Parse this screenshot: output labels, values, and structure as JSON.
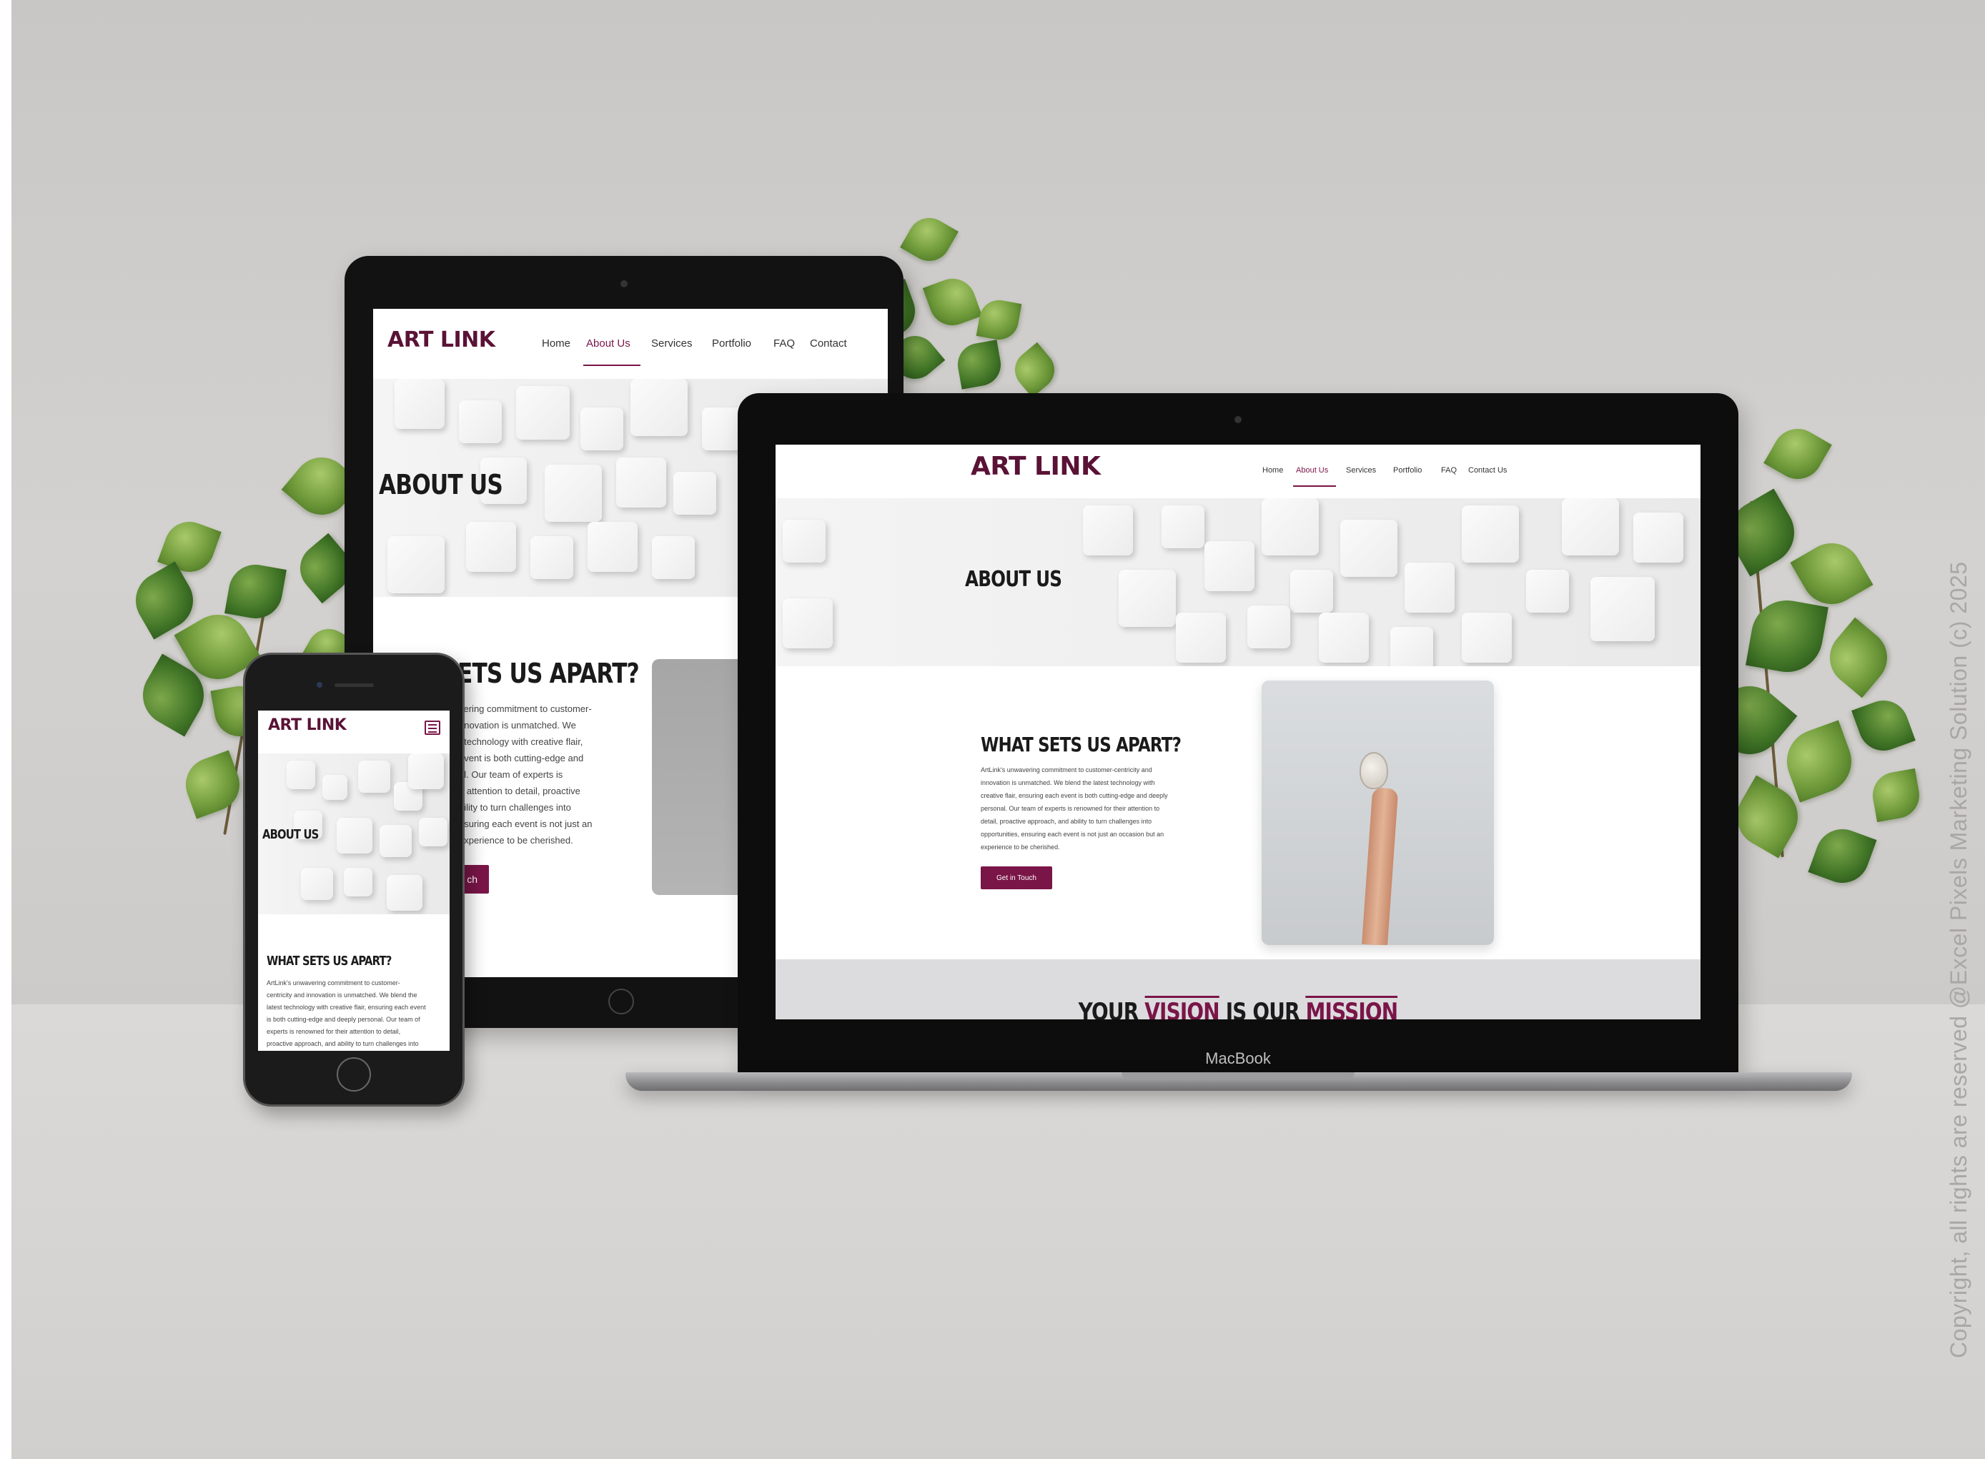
{
  "brand": {
    "logo_text": "ART LINK",
    "accent_color": "#7a1548"
  },
  "nav": {
    "items": [
      "Home",
      "About Us",
      "Services",
      "Portfolio",
      "FAQ",
      "Contact Us"
    ],
    "active": "About Us",
    "tablet_contact_truncated": "Contact"
  },
  "hero": {
    "title": "ABOUT US"
  },
  "section": {
    "heading": "WHAT SETS US APART?",
    "heading_tablet_cut": "ETS US APART?",
    "body": "ArtLink's unwavering commitment to customer-centricity and innovation is unmatched. We blend the latest technology with creative flair, ensuring each event is both cutting-edge and deeply personal. Our team of experts is renowned for their attention to detail, proactive approach, and ability to turn challenges into opportunities, ensuring each event is not just an occasion but an experience to be cherished.",
    "tablet_lines": [
      "vering commitment to customer-",
      "nnovation is unmatched. We",
      "t technology with creative flair,",
      "event is both cutting-edge and",
      "al. Our team of experts is",
      "ir attention to detail, proactive",
      "bility to turn challenges into",
      "nsuring each event is not just an",
      "experience to be cherished."
    ],
    "mobile_lines": [
      "ArtLink's unwavering commitment to customer-",
      "centricity and innovation is unmatched. We blend the",
      "latest technology with creative flair, ensuring each event",
      "is both cutting-edge and deeply personal. Our team of",
      "experts is renowned for their attention to detail,",
      "proactive approach, and ability to turn challenges into"
    ],
    "laptop_lines": [
      "ArtLink's unwavering commitment to customer-centricity and",
      "innovation is unmatched. We blend the latest technology with",
      "creative flair, ensuring each event is both cutting-edge and deeply",
      "personal. Our team of experts is renowned for their attention to",
      "detail, proactive approach, and ability to turn challenges into",
      "opportunities, ensuring each event is not just an occasion but an",
      "experience to be cherished."
    ],
    "button": "Get in Touch",
    "button_tablet_cut": "ch"
  },
  "banner": {
    "part1": "YOUR",
    "vision": "VISION",
    "part2": "IS OUR",
    "mission": "MISSION"
  },
  "laptop": {
    "brand_label": "MacBook"
  },
  "copyright": "Copyright, all rights are reserved @Excel Pixels Marketing Solution (c) 2025"
}
